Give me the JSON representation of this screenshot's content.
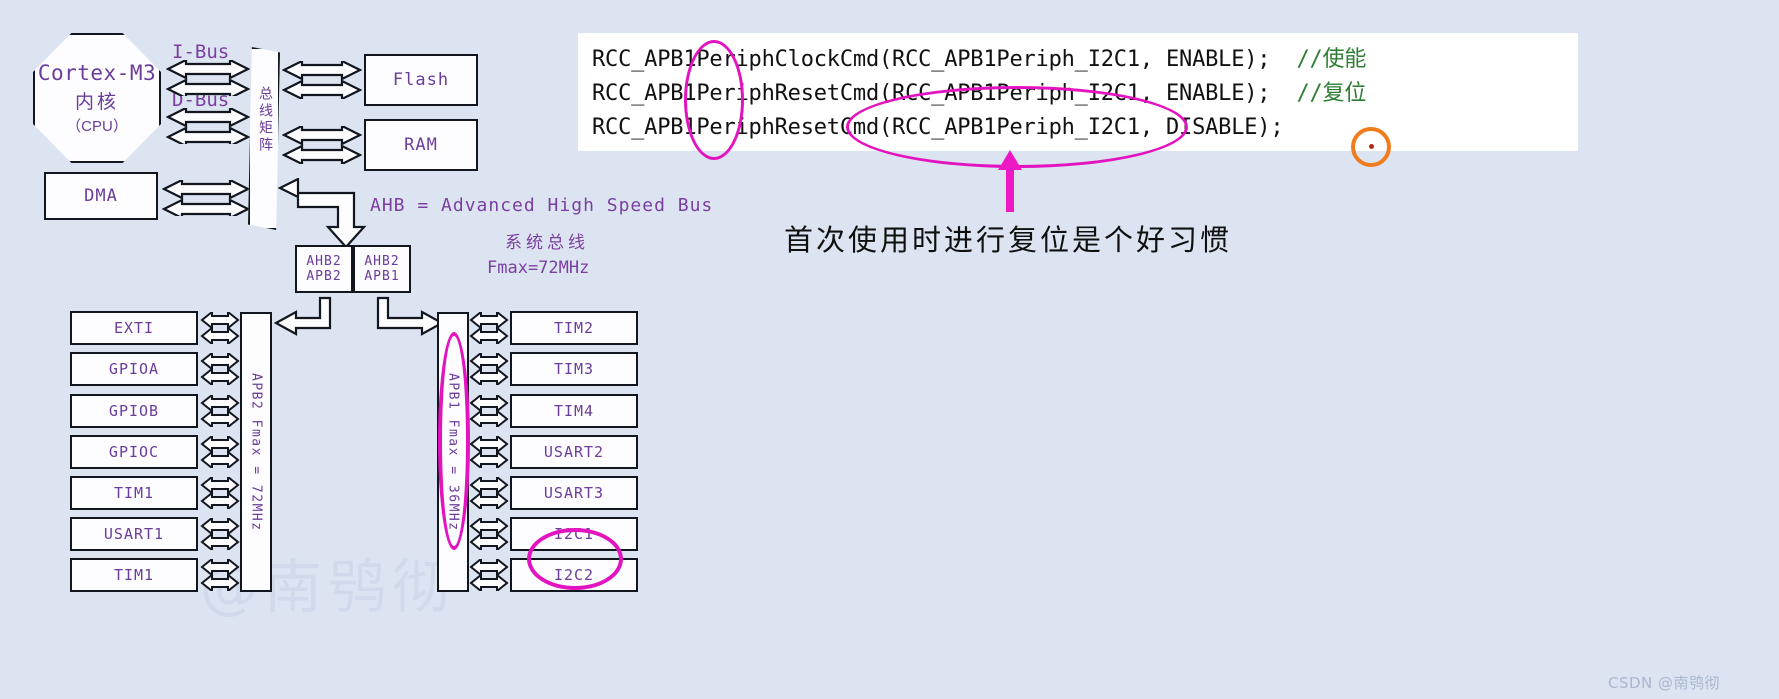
{
  "colors": {
    "background": "#dce4f2",
    "box_fill": "#fdfcff",
    "box_stroke": "#11161f",
    "label_purple": "#6a3d9a",
    "text_purple": "#7b3fa0",
    "highlight_magenta": "#e413c0",
    "highlight_orange": "#f07c1d",
    "comment_green": "#2e7d32",
    "code_black": "#111111"
  },
  "diagram": {
    "cpu": {
      "line1": "Cortex-M3",
      "line2": "内核",
      "line3": "（CPU）"
    },
    "dma": "DMA",
    "bus_labels": {
      "ibus": "I-Bus",
      "dbus": "D-Bus"
    },
    "bus_matrix": "总线矩阵",
    "memories": [
      {
        "label": "Flash"
      },
      {
        "label": "RAM"
      }
    ],
    "bridge_boxes": [
      {
        "top": "AHB2",
        "bottom": "APB2"
      },
      {
        "top": "AHB2",
        "bottom": "APB1"
      }
    ],
    "notes": {
      "ahb_expand": "AHB = Advanced High Speed Bus",
      "system_bus": "系统总线",
      "fmax": "Fmax=72MHz"
    },
    "apb2": {
      "bar_label": "APB2 Fmax = 72MHz",
      "peripherals": [
        "EXTI",
        "GPIOA",
        "GPIOB",
        "GPIOC",
        "TIM1",
        "USART1",
        "TIM1"
      ]
    },
    "apb1": {
      "bar_label": "APB1 Fmax = 36MHz",
      "peripherals": [
        "TIM2",
        "TIM3",
        "TIM4",
        "USART2",
        "USART3",
        "I2C1",
        "I2C2"
      ]
    }
  },
  "code": {
    "lines": [
      {
        "code": "RCC_APB1PeriphClockCmd(RCC_APB1Periph_I2C1, ENABLE);",
        "comment": "  //使能"
      },
      {
        "code": "RCC_APB1PeriphResetCmd(RCC_APB1Periph_I2C1, ENABLE);",
        "comment": "  //复位"
      },
      {
        "code": "RCC_APB1PeriphResetCmd(RCC_APB1Periph_I2C1, DISABLE);",
        "comment": ""
      }
    ]
  },
  "annotation": {
    "text": "首次使用时进行复位是个好习惯"
  },
  "watermark": {
    "text": "@南鸮彻",
    "credit": "CSDN @南鸮彻"
  }
}
